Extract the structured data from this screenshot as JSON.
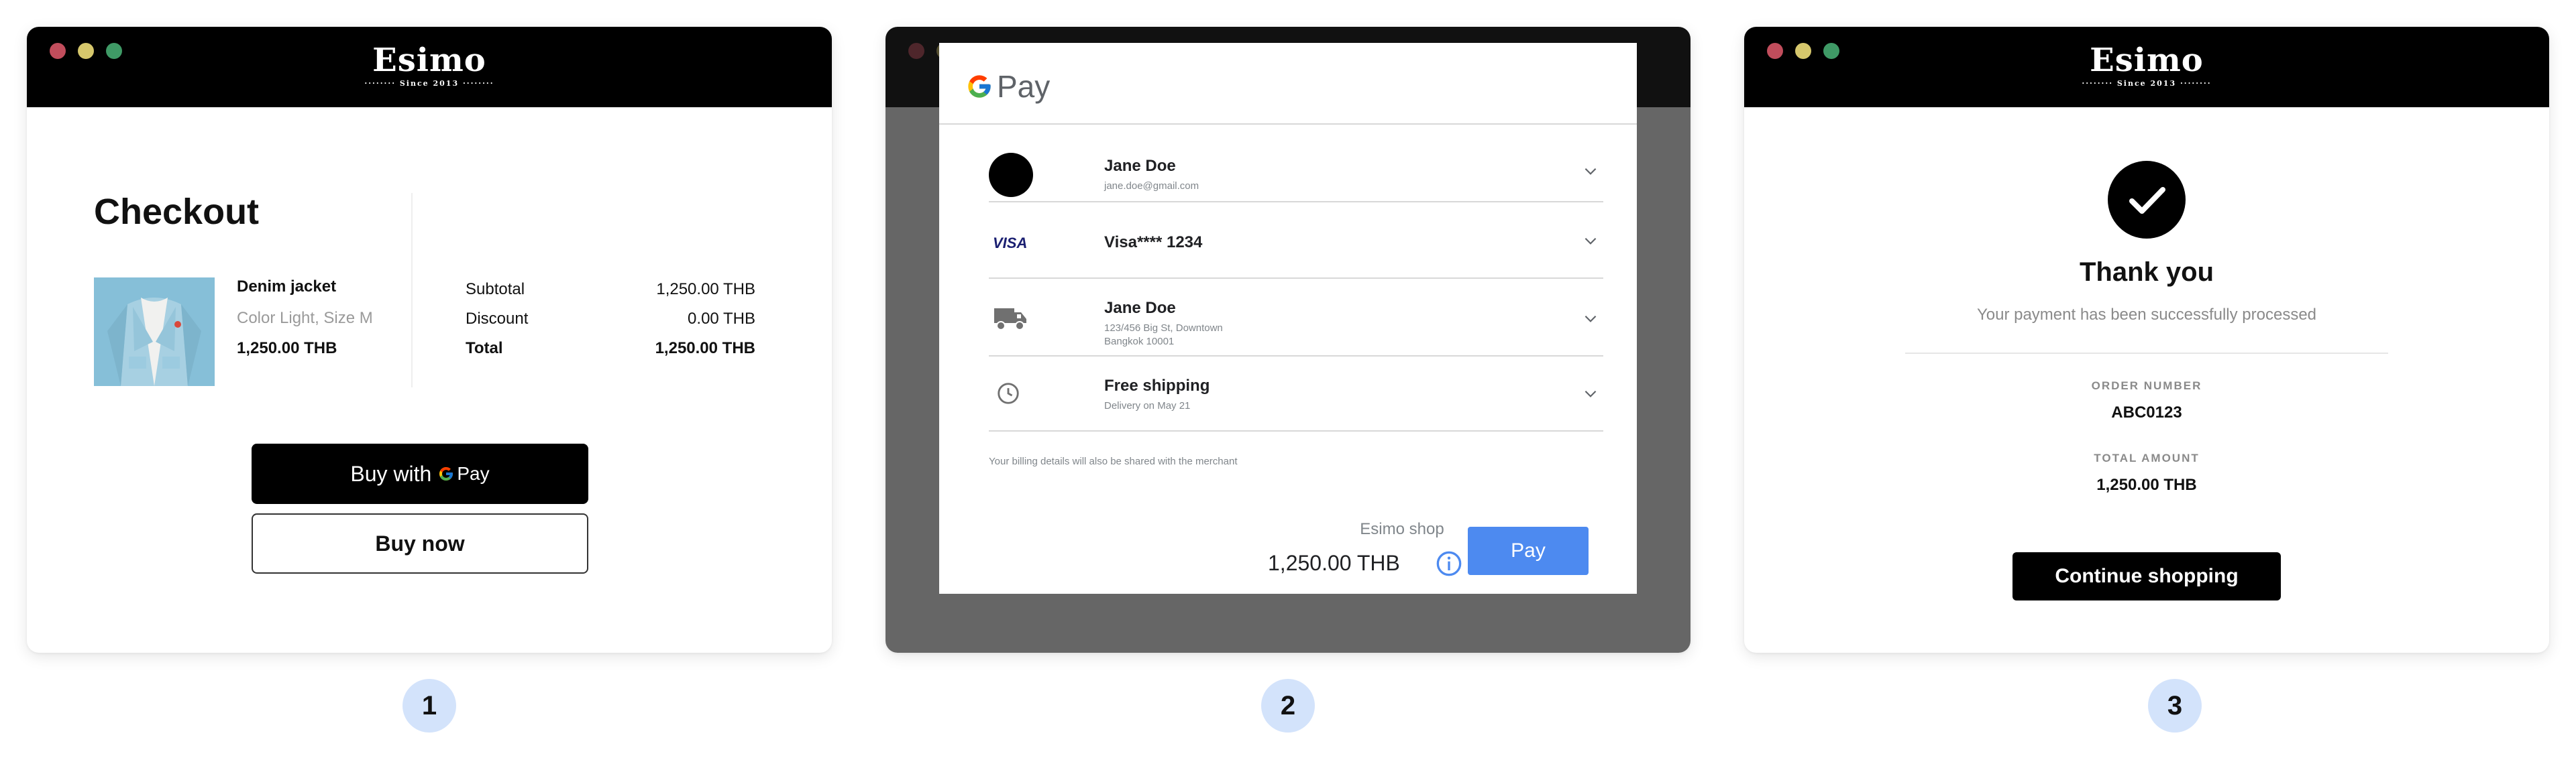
{
  "brand": {
    "name": "Esimo",
    "tagline": "········ Since 2013 ········"
  },
  "checkout": {
    "title": "Checkout",
    "product": {
      "name": "Denim jacket",
      "variant": "Color Light, Size M",
      "price": "1,250.00 THB"
    },
    "summary": [
      {
        "label": "Subtotal",
        "value": "1,250.00 THB"
      },
      {
        "label": "Discount",
        "value": "0.00 THB"
      },
      {
        "label": "Total",
        "value": "1,250.00 THB"
      }
    ],
    "buy_with_label": "Buy with",
    "gpay_mark": "Pay",
    "buy_now_label": "Buy now"
  },
  "gpay_sheet": {
    "logo_text": "Pay",
    "contact": {
      "name": "Jane Doe",
      "email": "jane.doe@gmail.com"
    },
    "payment": {
      "brand": "VISA",
      "label": "Visa**** 1234"
    },
    "shipping_address": {
      "name": "Jane Doe",
      "line1": "123/456 Big St, Downtown",
      "line2": "Bangkok 10001"
    },
    "shipping_method": {
      "title": "Free shipping",
      "sub": "Delivery on May 21"
    },
    "notice": "Your billing details will also be shared with the merchant",
    "merchant": "Esimo shop",
    "amount": "1,250.00 THB",
    "pay_label": "Pay",
    "colors": {
      "pay_button": "#4d8af0",
      "overlay": "#666666"
    }
  },
  "confirmation": {
    "title": "Thank you",
    "subtitle": "Your payment has been successfully processed",
    "order_number_label": "ORDER NUMBER",
    "order_number": "ABC0123",
    "total_amount_label": "TOTAL AMOUNT",
    "total_amount": "1,250.00 THB",
    "continue_label": "Continue shopping"
  },
  "steps": [
    "1",
    "2",
    "3"
  ]
}
